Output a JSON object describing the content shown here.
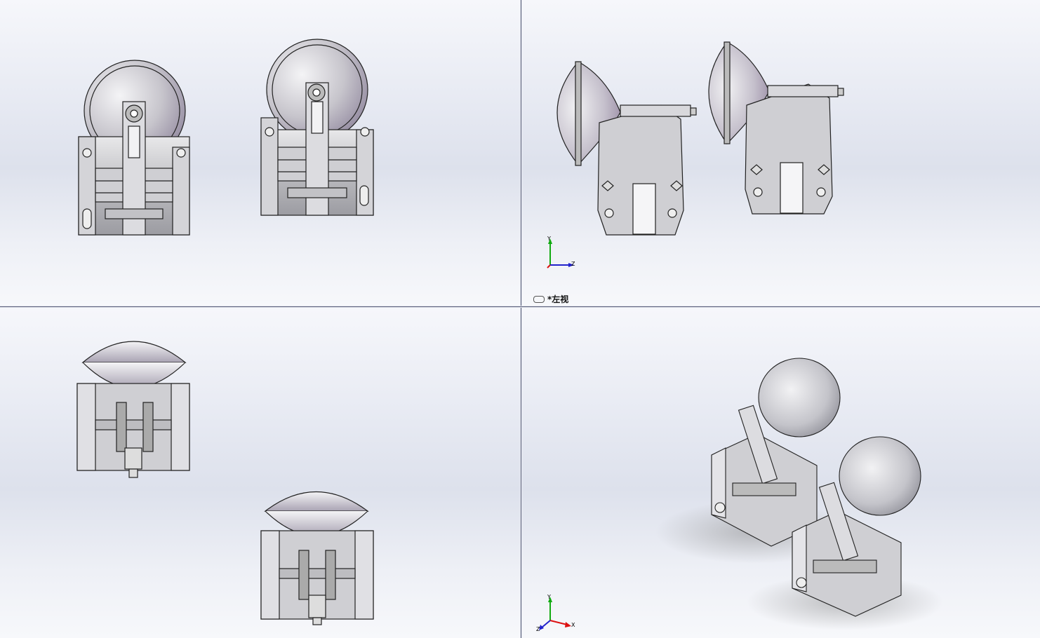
{
  "viewports": {
    "top_left": {
      "label": ""
    },
    "top_right": {
      "label": "*左视"
    },
    "bottom_left": {
      "label": ""
    },
    "bottom_right": {
      "label": ""
    }
  },
  "triad": {
    "x": "X",
    "y": "Y",
    "z": "Z"
  },
  "colors": {
    "metal": "#c9c9cc",
    "edge": "#2a2a2a",
    "dome": "#b8b8c0",
    "axis_x": "#d11",
    "axis_y": "#1a1",
    "axis_z": "#22c"
  }
}
